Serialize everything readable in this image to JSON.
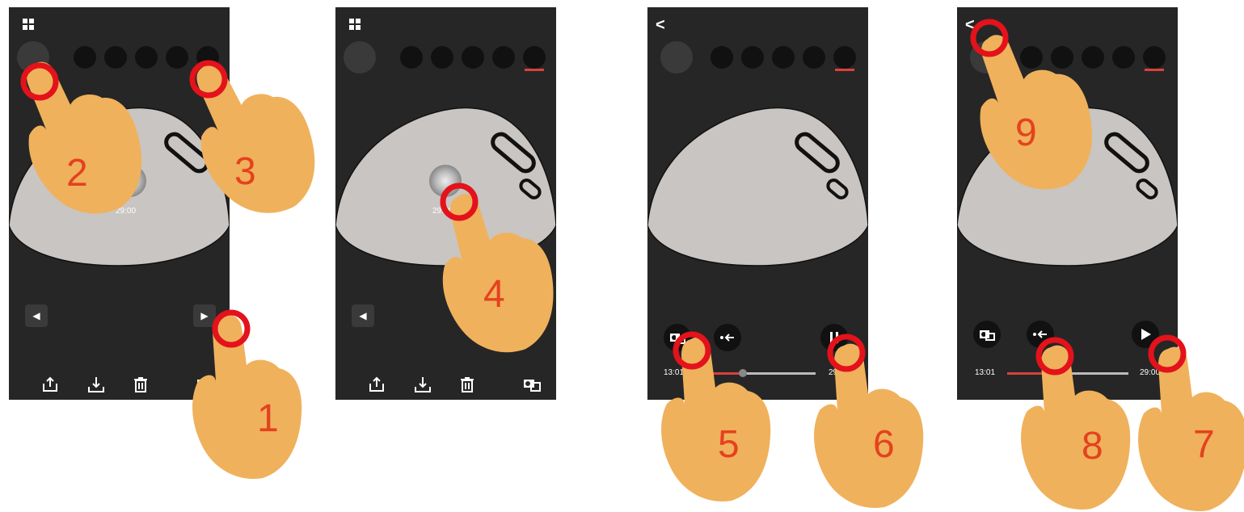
{
  "screens": [
    {
      "header": {
        "icon": "grid-icon"
      },
      "time_label": "29:00",
      "nav": {
        "prev": "◀",
        "next": "▶"
      },
      "bottom": {
        "icons": [
          "share-icon",
          "download-icon",
          "trash-icon",
          "camera-switch-icon"
        ]
      }
    },
    {
      "header": {
        "icon": "grid-icon"
      },
      "time_label": "29:00",
      "nav": {
        "prev": "◀"
      },
      "bottom": {
        "icons": [
          "share-icon",
          "download-icon",
          "trash-icon",
          "camera-switch-icon"
        ]
      }
    },
    {
      "header": {
        "back_label": "<"
      },
      "playback": {
        "start_time": "13:01",
        "end_time": "29:00",
        "progress": 0.4,
        "play_state": "pause"
      }
    },
    {
      "header": {
        "back_label": "<"
      },
      "playback": {
        "start_time": "13:01",
        "end_time": "29:00",
        "progress": 0.4,
        "play_state": "play"
      }
    }
  ],
  "steps": [
    "1",
    "2",
    "3",
    "4",
    "5",
    "6",
    "7",
    "8",
    "9"
  ],
  "colors": {
    "accent": "#d9423a",
    "hand": "#f0b15c",
    "marker": "#e3121b",
    "step_number": "#e4421f",
    "screen_bg": "#262626",
    "dome": "#c8c5c2"
  }
}
